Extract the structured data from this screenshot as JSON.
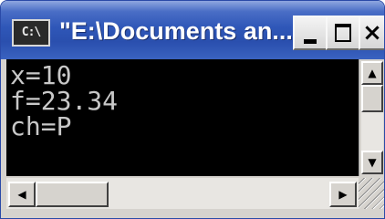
{
  "window": {
    "title": "\"E:\\Documents an...",
    "icon_label": "C:\\"
  },
  "title_buttons": {
    "minimize_icon": "minimize-icon",
    "maximize_icon": "maximize-icon",
    "close_label": "×"
  },
  "console": {
    "lines": [
      "x=10",
      "f=23.34",
      "ch=P"
    ]
  },
  "scrollbars": {
    "up_arrow": "▲",
    "down_arrow": "▼",
    "left_arrow": "◀",
    "right_arrow": "▶"
  },
  "colors": {
    "titlebar": "#2a4fae",
    "console_bg": "#000000",
    "console_text": "#c8c8c8"
  }
}
